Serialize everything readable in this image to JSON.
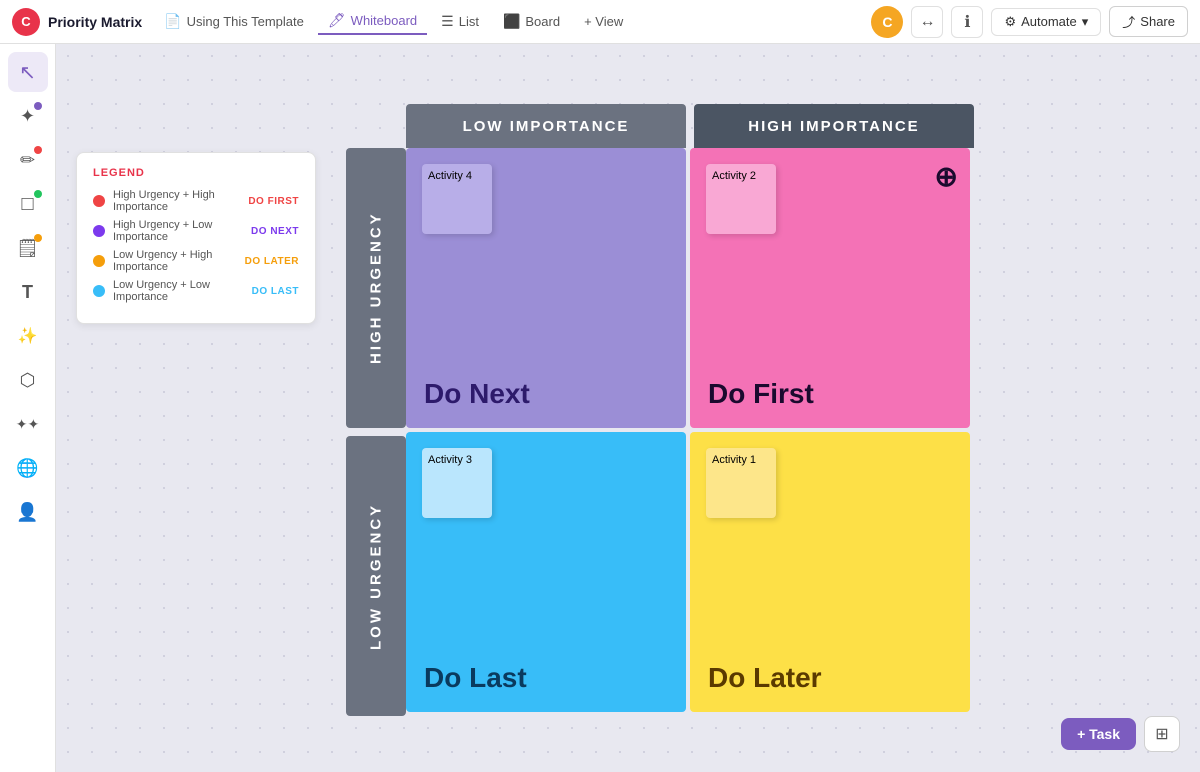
{
  "nav": {
    "logo_text": "C",
    "title": "Priority Matrix",
    "tabs": [
      {
        "id": "using-template",
        "label": "Using This Template",
        "icon": "📄",
        "active": false
      },
      {
        "id": "whiteboard",
        "label": "Whiteboard",
        "icon": "🖊",
        "active": true
      },
      {
        "id": "list",
        "label": "List",
        "icon": "☰",
        "active": false
      },
      {
        "id": "board",
        "label": "Board",
        "icon": "⬛",
        "active": false
      },
      {
        "id": "view",
        "label": "+ View",
        "icon": "",
        "active": false
      }
    ],
    "automate_label": "Automate",
    "share_label": "Share",
    "avatar": "C"
  },
  "legend": {
    "title": "LEGEND",
    "items": [
      {
        "color": "#ef4444",
        "label": "High Urgency + High Importance",
        "badge": "DO FIRST",
        "badge_color": "#ef4444"
      },
      {
        "color": "#7c3aed",
        "label": "High Urgency + Low Importance",
        "badge": "DO NEXT",
        "badge_color": "#7c3aed"
      },
      {
        "color": "#f59e0b",
        "label": "Low Urgency + High Importance",
        "badge": "DO LATER",
        "badge_color": "#f59e0b"
      },
      {
        "color": "#38bdf8",
        "label": "Low Urgency + Low Importance",
        "badge": "DO LAST",
        "badge_color": "#38bdf8"
      }
    ]
  },
  "matrix": {
    "col_headers": [
      {
        "id": "low-importance",
        "label": "LOW IMPORTANCE"
      },
      {
        "id": "high-importance",
        "label": "HIGH IMPORTANCE"
      }
    ],
    "row_headers": [
      {
        "id": "high-urgency",
        "label": "HIGH URGENCY"
      },
      {
        "id": "low-urgency",
        "label": "LOW URGENCY"
      }
    ],
    "cells": [
      {
        "id": "do-next",
        "label": "Do Next",
        "color": "#9b8ed6",
        "activity": "Activity 4",
        "sticky_color": "#b8aee8"
      },
      {
        "id": "do-first",
        "label": "Do First",
        "color": "#f472b6",
        "activity": "Activity 2",
        "sticky_color": "#f9a8d4",
        "icon": "!"
      },
      {
        "id": "do-last",
        "label": "Do Last",
        "color": "#38bdf8",
        "activity": "Activity 3",
        "sticky_color": "#bae6fd"
      },
      {
        "id": "do-later",
        "label": "Do Later",
        "color": "#fde047",
        "activity": "Activity 1",
        "sticky_color": "#fde68a"
      }
    ]
  },
  "tools": [
    {
      "id": "select",
      "icon": "↖",
      "active": true
    },
    {
      "id": "hand",
      "icon": "✦",
      "active": false,
      "dot_color": "#7c5cbf"
    },
    {
      "id": "pen",
      "icon": "✏",
      "active": false,
      "dot_color": "#ef4444"
    },
    {
      "id": "shape",
      "icon": "□",
      "active": false,
      "dot_color": "#22c55e"
    },
    {
      "id": "sticky",
      "icon": "🗒",
      "active": false,
      "dot_color": "#f59e0b"
    },
    {
      "id": "text",
      "icon": "T",
      "active": false
    },
    {
      "id": "magic",
      "icon": "✨",
      "active": false
    },
    {
      "id": "connect",
      "icon": "⬡",
      "active": false
    },
    {
      "id": "ai",
      "icon": "✦✦",
      "active": false
    },
    {
      "id": "globe",
      "icon": "🌐",
      "active": false
    },
    {
      "id": "person",
      "icon": "👤",
      "active": false
    }
  ],
  "bottom_bar": {
    "task_btn": "+ Task",
    "grid_icon": "⊞"
  }
}
